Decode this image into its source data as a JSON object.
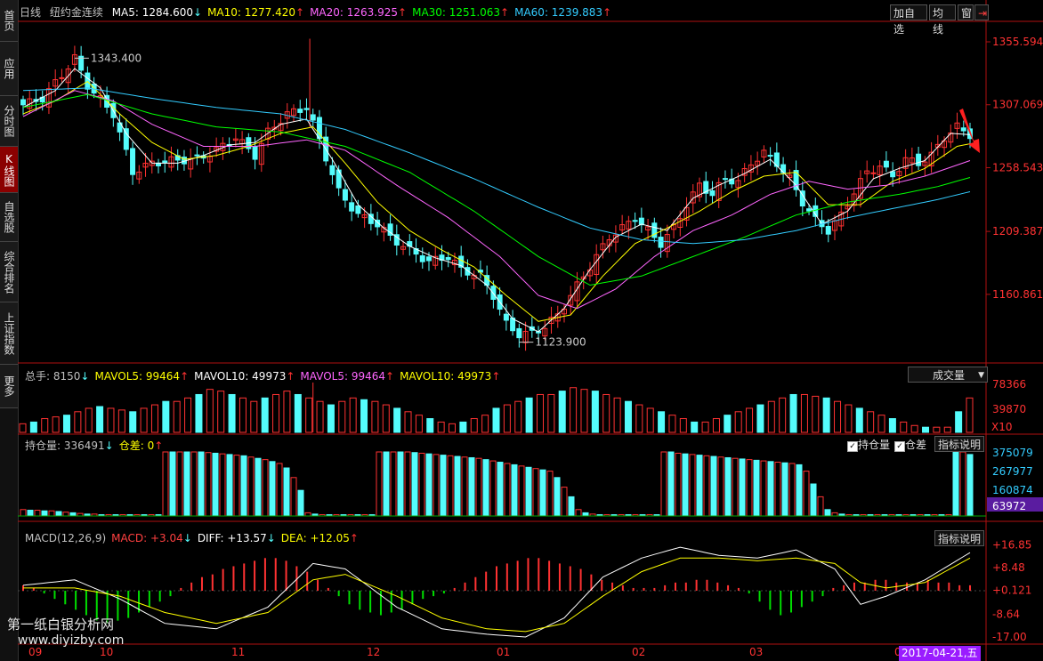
{
  "sidebar": {
    "tabs": [
      {
        "label": "首页",
        "active": false
      },
      {
        "label": "应用",
        "active": false
      },
      {
        "label": "分时图",
        "active": false
      },
      {
        "label": "K线图",
        "active": true
      },
      {
        "label": "自选股",
        "active": false
      },
      {
        "label": "综合排名",
        "active": false
      },
      {
        "label": "上证指数",
        "active": false
      },
      {
        "label": "更多",
        "active": false
      }
    ]
  },
  "header": {
    "period": "日线",
    "instrument": "纽约金连续",
    "ma": [
      {
        "label": "MA5: 1284.600",
        "arrow": "↓",
        "color": "#ffffff"
      },
      {
        "label": "MA10: 1277.420",
        "arrow": "↑",
        "color": "#ffff00"
      },
      {
        "label": "MA20: 1263.925",
        "arrow": "↑",
        "color": "#ff66ff"
      },
      {
        "label": "MA30: 1251.063",
        "arrow": "↑",
        "color": "#00ff00"
      },
      {
        "label": "MA60: 1239.883",
        "arrow": "↑",
        "color": "#33ccff"
      }
    ],
    "buttons": {
      "add_watch": "加自选",
      "avg_line": "均线",
      "window": "窗"
    }
  },
  "price_axis": [
    "1355.594",
    "1307.069",
    "1258.543",
    "1209.387",
    "1160.861"
  ],
  "price_annotations": {
    "high": "1343.400",
    "low": "1123.900"
  },
  "volume": {
    "header": [
      {
        "label": "总手: 8150",
        "arrow": "↓",
        "color": "#c0c0c0"
      },
      {
        "label": "MAVOL5: 99464",
        "arrow": "↑",
        "color": "#ffff00"
      },
      {
        "label": "MAVOL10: 49973",
        "arrow": "↑",
        "color": "#ffffff"
      },
      {
        "label": "MAVOL5: 99464",
        "arrow": "↑",
        "color": "#ff66ff"
      },
      {
        "label": "MAVOL10: 49973",
        "arrow": "↑",
        "color": "#ffff00"
      }
    ],
    "selector": "成交量",
    "axis": [
      "78366",
      "39870"
    ],
    "unit": "X10"
  },
  "open_interest": {
    "header": [
      {
        "label": "持仓量: 336491",
        "arrow": "↓",
        "color": "#c0c0c0"
      },
      {
        "label": "仓差: 0",
        "arrow": "↑",
        "color": "#ffff00"
      }
    ],
    "checkbox_oi": "持仓量",
    "checkbox_diff": "仓差",
    "help": "指标说明",
    "axis": [
      "375079",
      "267977",
      "160874",
      "63972"
    ]
  },
  "macd": {
    "header": [
      {
        "label": "MACD(12,26,9)",
        "arrow": "",
        "color": "#c0c0c0"
      },
      {
        "label": "MACD: +3.04",
        "arrow": "↓",
        "color": "#ff4040"
      },
      {
        "label": "DIFF: +13.57",
        "arrow": "↓",
        "color": "#ffffff"
      },
      {
        "label": "DEA: +12.05",
        "arrow": "↑",
        "color": "#ffff00"
      }
    ],
    "help": "指标说明",
    "axis": [
      "+16.85",
      "+8.48",
      "+0.121",
      "-8.64",
      "-17.00"
    ]
  },
  "time_axis": [
    "09",
    "10",
    "11",
    "12",
    "01",
    "02",
    "03",
    "04"
  ],
  "date_label": "2017-04-21,五",
  "watermark": {
    "title": "第一纸白银分析网",
    "url": "www.diyizby.com"
  },
  "colors": {
    "up": "#ff3232",
    "down": "#54fcfc",
    "axis": "#b01010"
  },
  "chart_data": {
    "type": "candlestick",
    "title": "纽约金连续",
    "y_range": [
      1110,
      1370
    ],
    "close_path": [
      [
        0,
        1307
      ],
      [
        3,
        1312
      ],
      [
        6,
        1330
      ],
      [
        8,
        1343
      ],
      [
        10,
        1322
      ],
      [
        14,
        1300
      ],
      [
        17,
        1255
      ],
      [
        20,
        1262
      ],
      [
        23,
        1264
      ],
      [
        27,
        1265
      ],
      [
        30,
        1272
      ],
      [
        33,
        1282
      ],
      [
        36,
        1268
      ],
      [
        38,
        1286
      ],
      [
        41,
        1300
      ],
      [
        44,
        1305
      ],
      [
        46,
        1280
      ],
      [
        49,
        1240
      ],
      [
        52,
        1222
      ],
      [
        55,
        1215
      ],
      [
        57,
        1205
      ],
      [
        60,
        1195
      ],
      [
        63,
        1186
      ],
      [
        66,
        1190
      ],
      [
        68,
        1180
      ],
      [
        71,
        1175
      ],
      [
        73,
        1160
      ],
      [
        75,
        1138
      ],
      [
        77,
        1130
      ],
      [
        79,
        1131
      ],
      [
        81,
        1136
      ],
      [
        83,
        1145
      ],
      [
        85,
        1160
      ],
      [
        87,
        1175
      ],
      [
        89,
        1190
      ],
      [
        91,
        1205
      ],
      [
        93,
        1212
      ],
      [
        95,
        1220
      ],
      [
        97,
        1210
      ],
      [
        99,
        1200
      ],
      [
        101,
        1212
      ],
      [
        103,
        1230
      ],
      [
        105,
        1245
      ],
      [
        107,
        1238
      ],
      [
        109,
        1250
      ],
      [
        111,
        1248
      ],
      [
        113,
        1262
      ],
      [
        115,
        1270
      ],
      [
        117,
        1262
      ],
      [
        119,
        1250
      ],
      [
        121,
        1232
      ],
      [
        123,
        1218
      ],
      [
        125,
        1210
      ],
      [
        127,
        1222
      ],
      [
        129,
        1240
      ],
      [
        131,
        1255
      ],
      [
        133,
        1260
      ],
      [
        135,
        1252
      ],
      [
        137,
        1265
      ],
      [
        139,
        1262
      ],
      [
        141,
        1268
      ],
      [
        143,
        1282
      ],
      [
        145,
        1290
      ],
      [
        147,
        1284
      ]
    ],
    "ma_series": [
      {
        "name": "MA5",
        "value": 1284.6,
        "path": [
          [
            0,
            1305
          ],
          [
            5,
            1318
          ],
          [
            8,
            1335
          ],
          [
            12,
            1320
          ],
          [
            16,
            1285
          ],
          [
            20,
            1262
          ],
          [
            24,
            1262
          ],
          [
            28,
            1268
          ],
          [
            32,
            1276
          ],
          [
            36,
            1278
          ],
          [
            40,
            1292
          ],
          [
            44,
            1296
          ],
          [
            48,
            1265
          ],
          [
            52,
            1230
          ],
          [
            56,
            1212
          ],
          [
            60,
            1198
          ],
          [
            64,
            1189
          ],
          [
            68,
            1183
          ],
          [
            72,
            1168
          ],
          [
            76,
            1142
          ],
          [
            80,
            1132
          ],
          [
            84,
            1150
          ],
          [
            88,
            1180
          ],
          [
            92,
            1205
          ],
          [
            96,
            1215
          ],
          [
            100,
            1210
          ],
          [
            104,
            1235
          ],
          [
            108,
            1245
          ],
          [
            112,
            1254
          ],
          [
            116,
            1265
          ],
          [
            120,
            1245
          ],
          [
            124,
            1215
          ],
          [
            128,
            1225
          ],
          [
            132,
            1250
          ],
          [
            136,
            1258
          ],
          [
            140,
            1264
          ],
          [
            144,
            1285
          ],
          [
            147,
            1284
          ]
        ]
      },
      {
        "name": "MA10",
        "value": 1277.42,
        "path": [
          [
            0,
            1300
          ],
          [
            5,
            1310
          ],
          [
            10,
            1325
          ],
          [
            15,
            1300
          ],
          [
            20,
            1278
          ],
          [
            25,
            1265
          ],
          [
            30,
            1268
          ],
          [
            35,
            1275
          ],
          [
            40,
            1285
          ],
          [
            45,
            1290
          ],
          [
            50,
            1262
          ],
          [
            55,
            1232
          ],
          [
            60,
            1210
          ],
          [
            65,
            1195
          ],
          [
            70,
            1182
          ],
          [
            75,
            1160
          ],
          [
            80,
            1140
          ],
          [
            85,
            1145
          ],
          [
            90,
            1175
          ],
          [
            95,
            1200
          ],
          [
            100,
            1212
          ],
          [
            105,
            1225
          ],
          [
            110,
            1240
          ],
          [
            115,
            1252
          ],
          [
            120,
            1255
          ],
          [
            125,
            1230
          ],
          [
            130,
            1230
          ],
          [
            135,
            1248
          ],
          [
            140,
            1258
          ],
          [
            145,
            1275
          ],
          [
            147,
            1277
          ]
        ]
      },
      {
        "name": "MA20",
        "value": 1263.925,
        "path": [
          [
            0,
            1298
          ],
          [
            8,
            1318
          ],
          [
            14,
            1310
          ],
          [
            20,
            1292
          ],
          [
            28,
            1275
          ],
          [
            36,
            1275
          ],
          [
            44,
            1280
          ],
          [
            50,
            1272
          ],
          [
            58,
            1245
          ],
          [
            66,
            1220
          ],
          [
            74,
            1190
          ],
          [
            80,
            1160
          ],
          [
            86,
            1150
          ],
          [
            92,
            1165
          ],
          [
            98,
            1190
          ],
          [
            104,
            1210
          ],
          [
            110,
            1222
          ],
          [
            116,
            1238
          ],
          [
            122,
            1248
          ],
          [
            128,
            1242
          ],
          [
            134,
            1245
          ],
          [
            140,
            1252
          ],
          [
            147,
            1264
          ]
        ]
      },
      {
        "name": "MA30",
        "value": 1251.063,
        "path": [
          [
            0,
            1305
          ],
          [
            10,
            1315
          ],
          [
            20,
            1300
          ],
          [
            30,
            1290
          ],
          [
            40,
            1286
          ],
          [
            50,
            1275
          ],
          [
            60,
            1255
          ],
          [
            70,
            1225
          ],
          [
            80,
            1190
          ],
          [
            88,
            1168
          ],
          [
            96,
            1175
          ],
          [
            104,
            1190
          ],
          [
            112,
            1205
          ],
          [
            120,
            1222
          ],
          [
            128,
            1232
          ],
          [
            136,
            1238
          ],
          [
            142,
            1244
          ],
          [
            147,
            1251
          ]
        ]
      },
      {
        "name": "MA60",
        "value": 1239.883,
        "path": [
          [
            0,
            1318
          ],
          [
            10,
            1320
          ],
          [
            20,
            1312
          ],
          [
            30,
            1305
          ],
          [
            40,
            1300
          ],
          [
            50,
            1288
          ],
          [
            60,
            1270
          ],
          [
            70,
            1250
          ],
          [
            80,
            1228
          ],
          [
            88,
            1212
          ],
          [
            96,
            1203
          ],
          [
            104,
            1200
          ],
          [
            112,
            1203
          ],
          [
            120,
            1210
          ],
          [
            128,
            1220
          ],
          [
            136,
            1228
          ],
          [
            142,
            1234
          ],
          [
            147,
            1240
          ]
        ]
      }
    ],
    "volume_values": [
      5,
      6,
      8,
      9,
      10,
      12,
      14,
      15,
      14,
      13,
      12,
      14,
      16,
      18,
      18,
      20,
      22,
      25,
      24,
      22,
      20,
      18,
      20,
      22,
      24,
      22,
      20,
      18,
      16,
      18,
      20,
      19,
      18,
      16,
      14,
      12,
      10,
      8,
      6,
      5,
      6,
      8,
      10,
      14,
      16,
      18,
      20,
      22,
      22,
      24,
      26,
      25,
      24,
      22,
      20,
      18,
      16,
      14,
      12,
      10,
      8,
      6,
      6,
      8,
      10,
      12,
      14,
      16,
      18,
      20,
      22,
      22,
      21,
      20,
      18,
      16,
      14,
      12,
      10,
      8,
      6,
      4,
      3,
      3,
      3,
      12,
      20
    ],
    "oi_values": [
      10,
      9,
      9,
      8,
      8,
      7,
      6,
      5,
      4,
      3,
      3,
      2,
      2,
      2,
      2,
      2,
      2,
      2,
      2,
      2,
      100,
      100,
      100,
      100,
      100,
      100,
      99,
      98,
      97,
      96,
      95,
      94,
      92,
      90,
      88,
      85,
      82,
      75,
      60,
      40,
      5,
      3,
      2,
      2,
      2,
      2,
      2,
      2,
      2,
      2,
      100,
      100,
      100,
      100,
      100,
      99,
      98,
      97,
      96,
      95,
      94,
      93,
      92,
      91,
      90,
      88,
      86,
      84,
      82,
      80,
      78,
      76,
      74,
      72,
      70,
      60,
      45,
      30,
      10,
      5,
      3,
      2,
      2,
      2,
      2,
      2,
      2,
      2,
      2,
      2,
      100,
      100,
      98,
      97,
      96,
      95,
      94,
      93,
      92,
      91,
      90,
      89,
      88,
      87,
      86,
      85,
      84,
      83,
      82,
      80,
      70,
      50,
      30,
      10,
      5,
      3,
      2,
      2,
      2,
      2,
      2,
      2,
      2,
      2,
      2,
      2,
      2,
      2,
      2,
      2,
      2,
      100,
      100,
      96
    ],
    "macd_hist": [
      2,
      1,
      -1,
      -3,
      -5,
      -7,
      -9,
      -11,
      -12,
      -11,
      -10,
      -8,
      -6,
      -4,
      -2,
      1,
      3,
      5,
      6,
      8,
      9,
      10,
      11,
      12,
      12,
      11,
      9,
      7,
      4,
      1,
      -2,
      -5,
      -7,
      -8,
      -9,
      -8,
      -7,
      -5,
      -3,
      -2,
      -1,
      1,
      3,
      5,
      7,
      9,
      10,
      11,
      12,
      12,
      11,
      10,
      9,
      8,
      6,
      4,
      3,
      2,
      1,
      1,
      1,
      2,
      3,
      3,
      4,
      4,
      3,
      2,
      1,
      -1,
      -4,
      -7,
      -9,
      -8,
      -6,
      -4,
      -2,
      1,
      2,
      3,
      3,
      4,
      4,
      3,
      3,
      3,
      4,
      3,
      3,
      2,
      2
    ],
    "diff_line": [
      [
        0,
        2
      ],
      [
        8,
        4
      ],
      [
        15,
        -3
      ],
      [
        22,
        -12
      ],
      [
        30,
        -14
      ],
      [
        38,
        -6
      ],
      [
        45,
        10
      ],
      [
        50,
        8
      ],
      [
        58,
        -6
      ],
      [
        65,
        -14
      ],
      [
        72,
        -16
      ],
      [
        78,
        -17
      ],
      [
        84,
        -10
      ],
      [
        90,
        5
      ],
      [
        96,
        12
      ],
      [
        102,
        16
      ],
      [
        108,
        13
      ],
      [
        114,
        12
      ],
      [
        120,
        15
      ],
      [
        126,
        8
      ],
      [
        130,
        -5
      ],
      [
        134,
        -2
      ],
      [
        140,
        4
      ],
      [
        147,
        14
      ]
    ],
    "dea_line": [
      [
        0,
        1
      ],
      [
        8,
        1
      ],
      [
        15,
        -2
      ],
      [
        22,
        -8
      ],
      [
        30,
        -12
      ],
      [
        38,
        -8
      ],
      [
        45,
        4
      ],
      [
        50,
        6
      ],
      [
        58,
        -2
      ],
      [
        65,
        -10
      ],
      [
        72,
        -14
      ],
      [
        78,
        -15
      ],
      [
        84,
        -12
      ],
      [
        90,
        -2
      ],
      [
        96,
        7
      ],
      [
        102,
        12
      ],
      [
        108,
        12
      ],
      [
        114,
        11
      ],
      [
        120,
        12
      ],
      [
        126,
        10
      ],
      [
        130,
        3
      ],
      [
        134,
        1
      ],
      [
        140,
        3
      ],
      [
        147,
        12
      ]
    ]
  }
}
